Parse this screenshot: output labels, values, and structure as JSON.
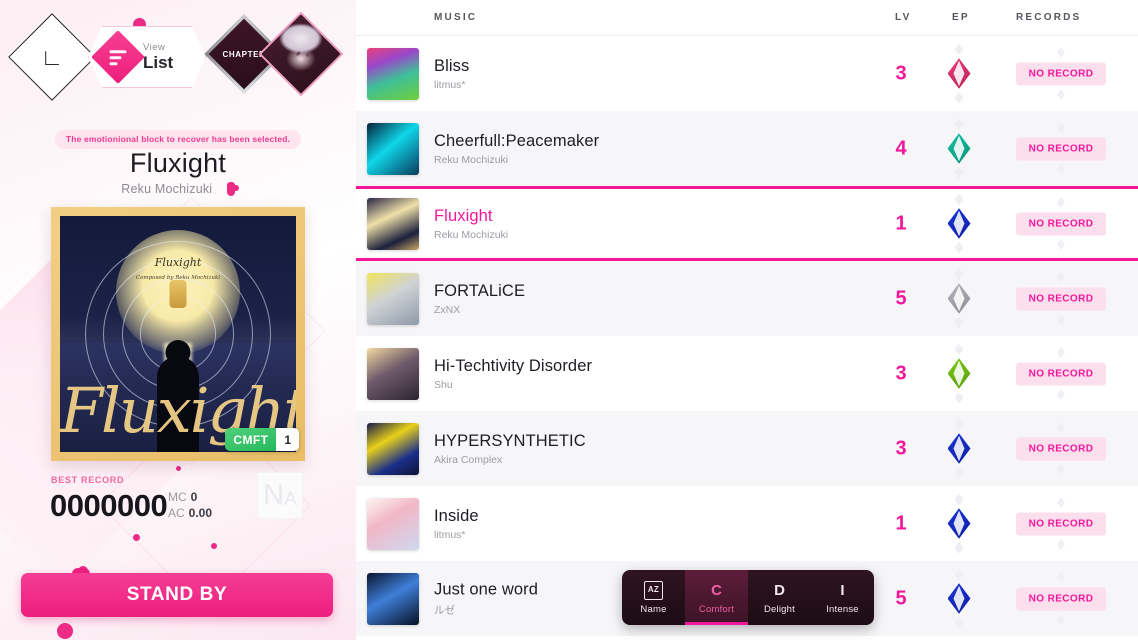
{
  "nav": {
    "back_icon": "back-arrow-icon",
    "view_sub": "View",
    "view_main": "List",
    "chapter_label": "CHAPTER",
    "avatar_name": "character-avatar"
  },
  "detail": {
    "banner": "The emotionional block to recover has been selected.",
    "title": "Fluxight",
    "artist": "Reku Mochizuki",
    "jacket": {
      "script_text": "Fluxight",
      "top_title": "Fluxight",
      "top_sub": "Composed by Reku Mochizuki",
      "cmft_label": "CMFT",
      "cmft_value": "1"
    },
    "best_record_label": "BEST RECORD",
    "score": "0000000",
    "mc_label": "MC",
    "mc_value": "0",
    "ac_label": "AC",
    "ac_value": "0.00",
    "rank_primary": "N",
    "rank_secondary": "A",
    "standby_label": "STAND BY"
  },
  "list": {
    "headers": {
      "music": "MUSIC",
      "lv": "LV",
      "ep": "EP",
      "records": "RECORDS"
    },
    "no_record_label": "NO RECORD",
    "rows": [
      {
        "title": "Bliss",
        "artist": "litmus*",
        "lv": "3",
        "gem_color": "#ec3f7e",
        "gem_dark": "#b81f56",
        "record": "NO RECORD",
        "selected": false
      },
      {
        "title": "Cheerfull:Peacemaker",
        "artist": "Reku Mochizuki",
        "lv": "4",
        "gem_color": "#12c4a4",
        "gem_dark": "#0a8f78",
        "record": "NO RECORD",
        "selected": false
      },
      {
        "title": "Fluxight",
        "artist": "Reku Mochizuki",
        "lv": "1",
        "gem_color": "#1a35dc",
        "gem_dark": "#0f1f9e",
        "record": "NO RECORD",
        "selected": true
      },
      {
        "title": "FORTALiCE",
        "artist": "ZxNX",
        "lv": "5",
        "gem_color": "#b7b7bd",
        "gem_dark": "#8a8a92",
        "record": "NO RECORD",
        "selected": false
      },
      {
        "title": "Hi-Techtivity Disorder",
        "artist": "Shu",
        "lv": "3",
        "gem_color": "#7ccc16",
        "gem_dark": "#5a9a0c",
        "record": "NO RECORD",
        "selected": false
      },
      {
        "title": "HYPERSYNTHETIC",
        "artist": "Akira Complex",
        "lv": "3",
        "gem_color": "#1a35dc",
        "gem_dark": "#0f1f9e",
        "record": "NO RECORD",
        "selected": false
      },
      {
        "title": "Inside",
        "artist": "litmus*",
        "lv": "1",
        "gem_color": "#1a35dc",
        "gem_dark": "#0f1f9e",
        "record": "NO RECORD",
        "selected": false
      },
      {
        "title": "Just one word",
        "artist": "ルゼ",
        "lv": "5",
        "gem_color": "#1a35dc",
        "gem_dark": "#0f1f9e",
        "record": "NO RECORD",
        "selected": false
      }
    ]
  },
  "filter_bar": {
    "tabs": [
      {
        "icon": "AZ",
        "label": "Name",
        "active": false
      },
      {
        "icon": "C",
        "label": "Comfort",
        "active": true
      },
      {
        "icon": "D",
        "label": "Delight",
        "active": false
      },
      {
        "icon": "I",
        "label": "Intense",
        "active": false
      }
    ]
  },
  "colors": {
    "accent_pink": "#f5179b",
    "accent_magenta": "#ec1f7d",
    "badge_bg": "#fcdfec",
    "cmft_green": "#28b85c"
  }
}
